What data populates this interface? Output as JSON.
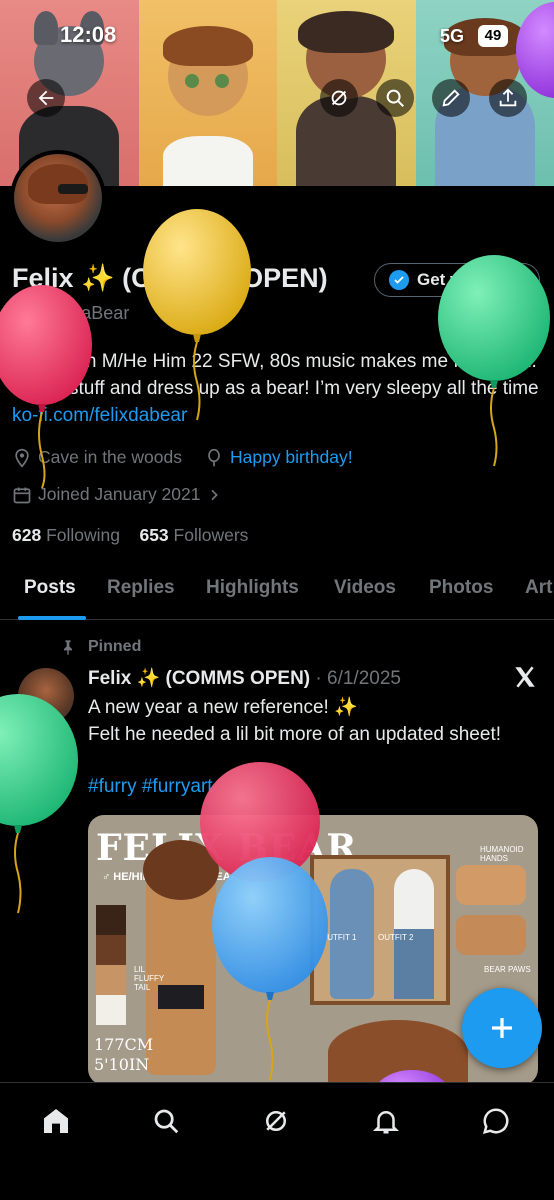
{
  "status": {
    "time": "12:08",
    "network": "5G",
    "battery": "49"
  },
  "profile": {
    "name": "Felix ✨ (COMMS OPEN)",
    "handle": "@FelixDaBear",
    "get_verified": "Get verified",
    "bio_text": "Australian M/He Him 22 SFW, 80s music makes me feel good. I draw stuff and dress up as a bear! I’m very sleepy all the time ",
    "bio_link": "ko-fi.com/felixdabear",
    "location": "Cave in the woods",
    "birthday": "Happy birthday!",
    "joined": "Joined January 2021",
    "following_count": "628",
    "following_label": "Following",
    "followers_count": "653",
    "followers_label": "Followers"
  },
  "tabs": [
    "Posts",
    "Replies",
    "Highlights",
    "Videos",
    "Photos",
    "Art"
  ],
  "tweet": {
    "pinned_label": "Pinned",
    "author": "Felix ✨ (COMMS OPEN)",
    "date": "· 6/1/2025",
    "line1": "A new year a new reference! ✨",
    "line2": "Felt he needed a lil bit more of an updated sheet!",
    "hashtags": "#furry #furryart"
  },
  "media": {
    "title": "FELIX BEAR",
    "subtitle": "♂ HE/HIM · BROWN BEAR",
    "height": "177CM 5'10IN",
    "notes": [
      "OUTFIT 1",
      "OUTFIT 2",
      "HUMANOID HANDS",
      "BEAR PAWS",
      "LIL FLUFFY TAIL"
    ]
  },
  "icons": {
    "back": "back-arrow-icon",
    "grok": "grok-icon",
    "search": "search-icon",
    "edit": "pencil-icon",
    "share": "share-icon",
    "location": "location-pin-icon",
    "balloon": "balloon-icon",
    "calendar": "calendar-icon",
    "pin": "pin-icon",
    "x": "x-logo-icon",
    "fab": "plus-icon",
    "home": "home-icon",
    "notifications": "bell-icon",
    "messages": "message-icon"
  },
  "colors": {
    "accent": "#1d9bf0",
    "muted": "#71767b",
    "text": "#e7e9ea",
    "background": "#000000"
  }
}
